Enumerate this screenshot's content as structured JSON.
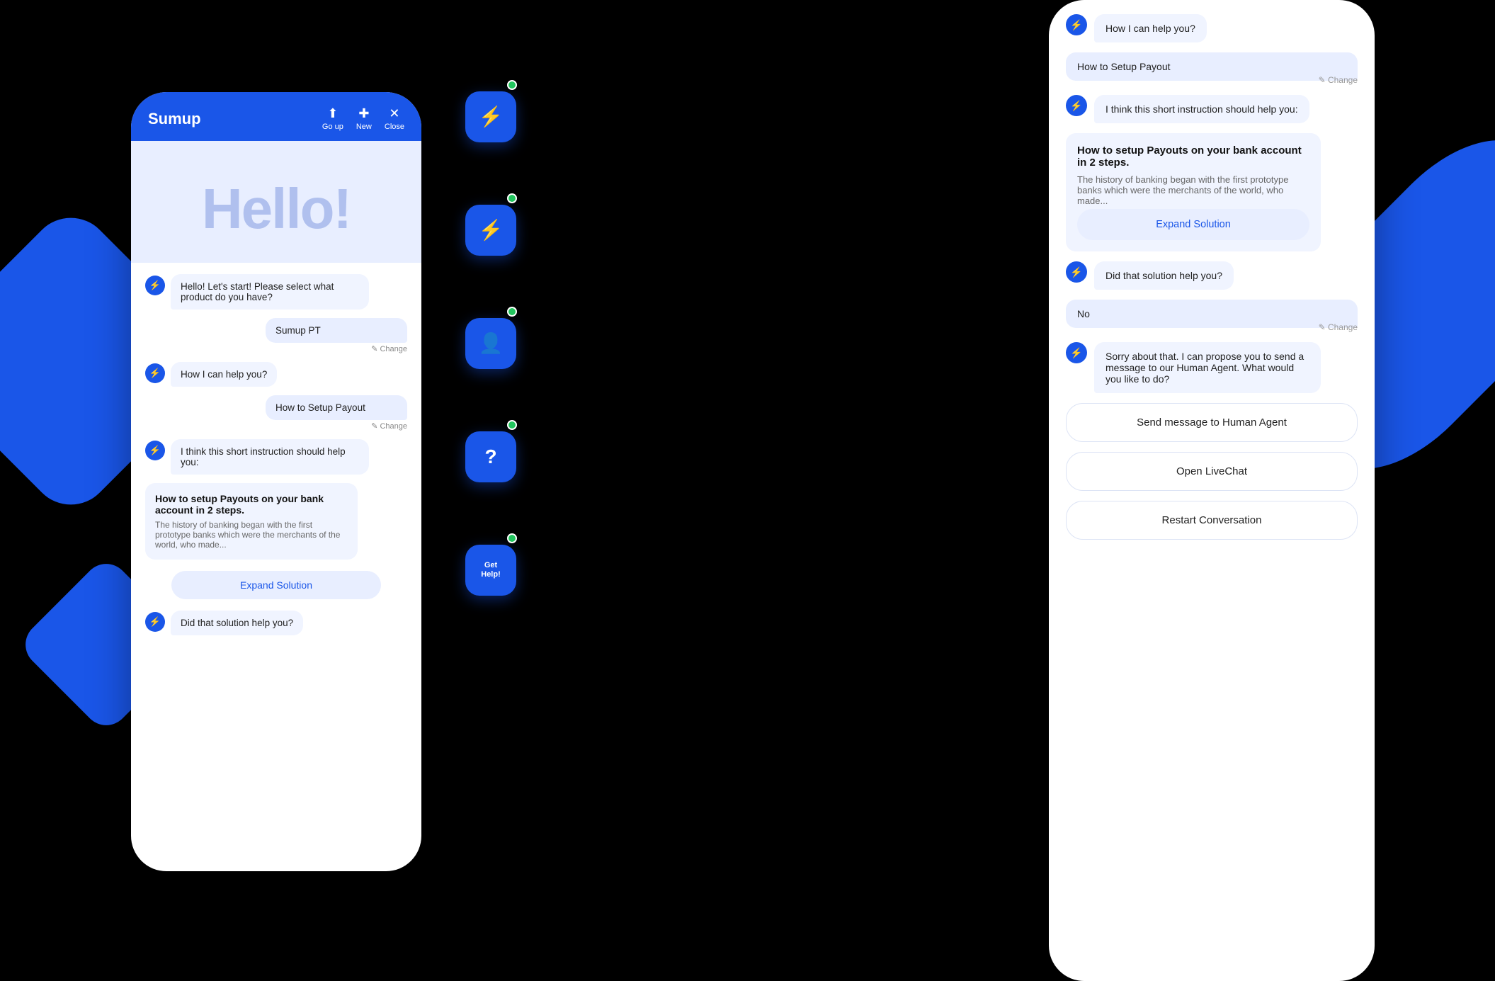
{
  "background": "#000",
  "left_phone": {
    "header": {
      "title": "Sumup",
      "go_up": "Go up",
      "new": "New",
      "close": "Close"
    },
    "hello": "Hello!",
    "messages": [
      {
        "type": "bot",
        "text": "Hello! Let's start! Please select what product do you have?"
      },
      {
        "type": "user",
        "text": "Sumup PT",
        "change": "✎ Change"
      },
      {
        "type": "bot",
        "text": "How I can help you?"
      },
      {
        "type": "user",
        "text": "How to Setup Payout",
        "change": "✎ Change"
      },
      {
        "type": "bot",
        "text": "I think this short instruction should help you:"
      },
      {
        "type": "solution",
        "title": "How to setup Payouts on your bank account in 2 steps.",
        "body": "The history of banking began with the first prototype banks which were the merchants of the world, who made..."
      },
      {
        "type": "expand",
        "label": "Expand Solution"
      },
      {
        "type": "bot_question",
        "text": "Did that solution help you?"
      }
    ]
  },
  "widgets": [
    {
      "icon": "⚡",
      "has_dot": true,
      "type": "logo"
    },
    {
      "icon": "⚡",
      "has_dot": true,
      "type": "bolt"
    },
    {
      "icon": "?",
      "has_dot": true,
      "type": "question"
    },
    {
      "icon": "Get\nHelp!",
      "has_dot": true,
      "type": "text"
    }
  ],
  "right_phone": {
    "messages": [
      {
        "type": "bot",
        "text": "How I can help you?"
      },
      {
        "type": "user",
        "text": "How to Setup Payout"
      },
      {
        "type": "change",
        "text": "✎ Change"
      },
      {
        "type": "bot",
        "text": "I think this short instruction should help you:"
      },
      {
        "type": "solution",
        "title": "How to setup Payouts on your bank account in 2 steps.",
        "body": "The history of banking began with the first prototype banks which were the merchants of the world, who made..."
      },
      {
        "type": "expand",
        "label": "Expand Solution"
      },
      {
        "type": "bot",
        "text": "Did that solution help you?"
      },
      {
        "type": "user",
        "text": "No"
      },
      {
        "type": "change",
        "text": "✎ Change"
      },
      {
        "type": "bot",
        "text": "Sorry about that. I can propose you to send a message to our Human Agent. What would you like to do?"
      },
      {
        "type": "action",
        "label": "Send message to Human Agent"
      },
      {
        "type": "action",
        "label": "Open LiveChat"
      },
      {
        "type": "action",
        "label": "Restart Conversation"
      }
    ]
  }
}
